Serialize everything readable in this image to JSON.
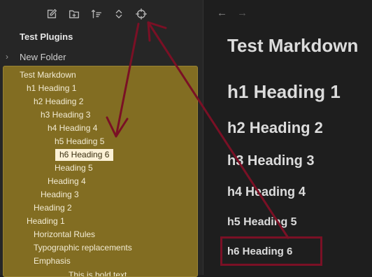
{
  "sidebar": {
    "toolbar": [
      {
        "name": "new-note-icon",
        "label": ""
      },
      {
        "name": "new-folder-icon",
        "label": ""
      },
      {
        "name": "sort-icon",
        "label": ""
      },
      {
        "name": "collapse-expand-icon",
        "label": ""
      },
      {
        "name": "locate-file-icon",
        "label": ""
      }
    ],
    "vault_title": "Test Plugins",
    "folder": {
      "label": "New Folder",
      "chevron": "›"
    },
    "outline": [
      {
        "label": "Test Markdown"
      },
      {
        "label": "h1 Heading 1"
      },
      {
        "label": "h2 Heading 2"
      },
      {
        "label": "h3 Heading 3"
      },
      {
        "label": "h4 Heading 4"
      },
      {
        "label": "h5 Heading 5"
      },
      {
        "label": "h6 Heading 6",
        "active": true
      },
      {
        "label": "Heading 5"
      },
      {
        "label": "Heading 4"
      },
      {
        "label": "Heading 3"
      },
      {
        "label": "Heading 2"
      },
      {
        "label": "Heading 1"
      },
      {
        "label": "Horizontal Rules"
      },
      {
        "label": "Typographic replacements"
      },
      {
        "label": "Emphasis"
      },
      {
        "label": "This is bold text"
      }
    ]
  },
  "nav": {
    "back": "←",
    "forward": "→"
  },
  "editor": {
    "title": "Test Markdown",
    "headings": [
      "h1 Heading 1",
      "h2 Heading 2",
      "h3 Heading 3",
      "h4 Heading 4",
      "h5 Heading 5",
      "h6 Heading 6"
    ]
  },
  "colors": {
    "outline_bg": "#826d22",
    "annotation": "#7a1025",
    "active_item_bg": "#fbf1d6"
  }
}
